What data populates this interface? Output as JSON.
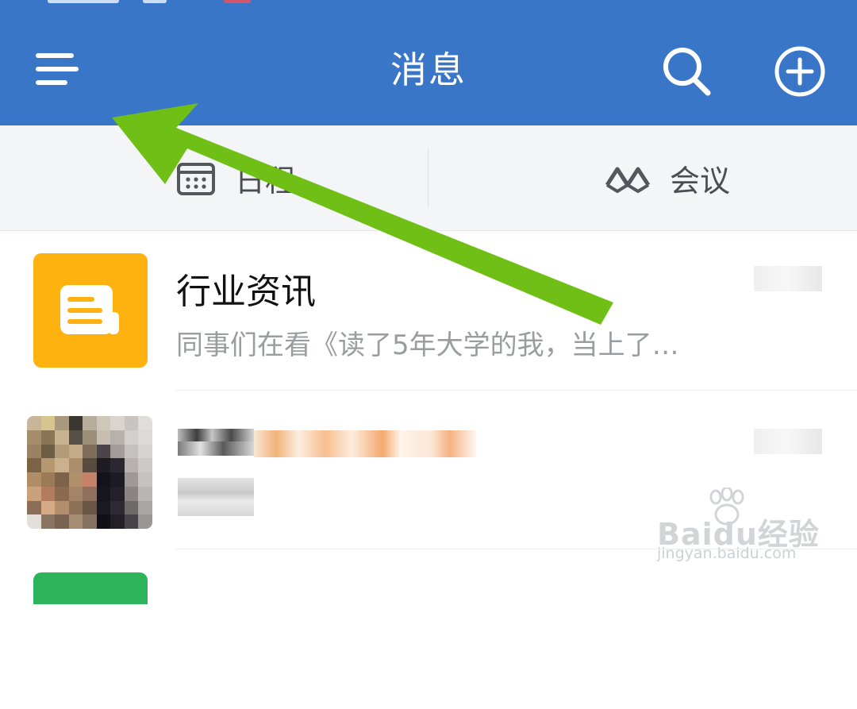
{
  "header": {
    "title": "消息",
    "menu_icon": "menu-icon",
    "search_icon": "search-icon",
    "add_icon": "add-circle-icon",
    "background": "#3a76c8"
  },
  "shortcuts": [
    {
      "label": "日程",
      "icon": "calendar-icon"
    },
    {
      "label": "会议",
      "icon": "meeting-icon"
    }
  ],
  "messages": [
    {
      "title": "行业资讯",
      "preview": "同事们在看《读了5年大学的我，当上了…",
      "avatar_icon": "news-icon",
      "avatar_color": "#fdb20f"
    },
    {
      "title": "",
      "preview": "",
      "avatar_icon": "user-avatar"
    },
    {
      "avatar_color": "#2db35a"
    }
  ],
  "overlay": {
    "arrow_color": "#6fbf16",
    "icon": "green-arrow-annotation"
  },
  "watermark": {
    "brand": "Baidu经验",
    "url": "jingyan.baidu.com"
  }
}
